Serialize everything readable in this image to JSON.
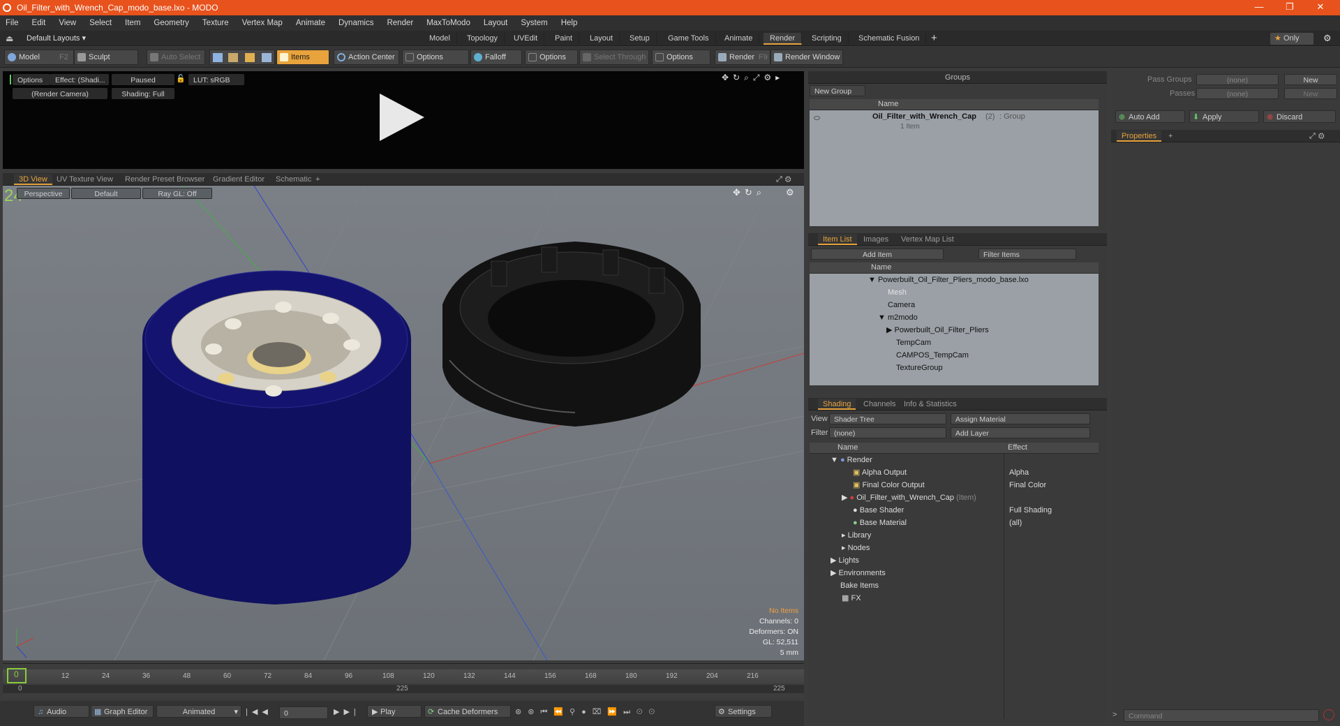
{
  "window": {
    "title": "Oil_Filter_with_Wrench_Cap_modo_base.lxo - MODO",
    "controls": [
      "—",
      "❐",
      "✕"
    ]
  },
  "menu": [
    "File",
    "Edit",
    "View",
    "Select",
    "Item",
    "Geometry",
    "Texture",
    "Vertex Map",
    "Animate",
    "Dynamics",
    "Render",
    "MaxToModo",
    "Layout",
    "System",
    "Help"
  ],
  "layout": {
    "dropdown": "Default Layouts ▾",
    "tabs": [
      "Model",
      "Topology",
      "UVEdit",
      "Paint",
      "Layout",
      "Setup",
      "Game Tools",
      "Animate",
      "Render",
      "Scripting",
      "Schematic Fusion"
    ],
    "active_tab": "Render",
    "plus": "+",
    "only": "Only"
  },
  "toolbar": {
    "model": "Model",
    "model_key": "F2",
    "sculpt": "Sculpt",
    "auto_select": "Auto Select",
    "items": "Items",
    "action_center": "Action Center",
    "options1": "Options",
    "falloff": "Falloff",
    "options2": "Options",
    "select_through": "Select Through",
    "options3": "Options",
    "render": "Render",
    "render_key": "F9",
    "render_window": "Render Window"
  },
  "preview": {
    "options": "Options",
    "effect": "Effect: (Shadi...",
    "paused": "Paused",
    "lut": "LUT: sRGB",
    "camera": "(Render Camera)",
    "shading": "Shading: Full"
  },
  "viewport_tabs": [
    "3D View",
    "UV Texture View",
    "Render Preset Browser",
    "Gradient Editor",
    "Schematic"
  ],
  "viewport": {
    "perspective": "Perspective",
    "default": "Default",
    "raygl": "Ray GL: Off",
    "stats": [
      "No Items",
      "Channels: 0",
      "Deformers: ON",
      "GL: 52,511",
      "5 mm"
    ]
  },
  "timeline": {
    "ticks": [
      "0",
      "12",
      "24",
      "36",
      "48",
      "60",
      "72",
      "84",
      "96",
      "108",
      "120",
      "132",
      "144",
      "156",
      "168",
      "180",
      "192",
      "204",
      "216"
    ],
    "start": "0",
    "mid": "225",
    "end": "225"
  },
  "bottom": {
    "audio": "Audio",
    "graph_editor": "Graph Editor",
    "animated": "Animated",
    "frame": "0",
    "play": "Play",
    "cache": "Cache Deformers",
    "settings": "Settings"
  },
  "groups": {
    "title": "Groups",
    "new_group": "New Group",
    "col_name": "Name",
    "item_name": "Oil_Filter_with_Wrench_Cap",
    "item_count": "(2)",
    "item_type": ": Group",
    "item_sub": "1 Item"
  },
  "itemlist": {
    "tabs": [
      "Item List",
      "Images",
      "Vertex Map List"
    ],
    "add_item": "Add Item",
    "filter": "Filter Items",
    "col_name": "Name",
    "rows": [
      {
        "label": "Powerbuilt_Oil_Filter_Pliers_modo_base.lxo",
        "indent": 0,
        "arrow": "▼",
        "dim": false
      },
      {
        "label": "Mesh",
        "indent": 1,
        "arrow": "",
        "dim": true
      },
      {
        "label": "Camera",
        "indent": 1,
        "arrow": "",
        "dim": false
      },
      {
        "label": "m2modo",
        "indent": 1,
        "arrow": "▼",
        "dim": false
      },
      {
        "label": "Powerbuilt_Oil_Filter_Pliers",
        "indent": 2,
        "arrow": "▶",
        "dim": false
      },
      {
        "label": "TempCam",
        "indent": 2,
        "arrow": "",
        "dim": false
      },
      {
        "label": "CAMPOS_TempCam",
        "indent": 2,
        "arrow": "",
        "dim": false
      },
      {
        "label": "TextureGroup",
        "indent": 2,
        "arrow": "",
        "dim": false
      }
    ]
  },
  "shading": {
    "tabs": [
      "Shading",
      "Channels",
      "Info & Statistics"
    ],
    "view_label": "View",
    "view_value": "Shader Tree",
    "assign": "Assign Material",
    "filter_label": "Filter",
    "filter_value": "(none)",
    "add_layer": "Add Layer",
    "col_name": "Name",
    "col_effect": "Effect",
    "rows": [
      {
        "label": "Render",
        "effect": "",
        "indent": 0,
        "extra": ""
      },
      {
        "label": "Alpha Output",
        "effect": "Alpha",
        "indent": 1,
        "extra": ""
      },
      {
        "label": "Final Color Output",
        "effect": "Final Color",
        "indent": 1,
        "extra": ""
      },
      {
        "label": "Oil_Filter_with_Wrench_Cap",
        "effect": "",
        "indent": 1,
        "extra": "(Item)"
      },
      {
        "label": "Base Shader",
        "effect": "Full Shading",
        "indent": 1,
        "extra": ""
      },
      {
        "label": "Base Material",
        "effect": "(all)",
        "indent": 1,
        "extra": ""
      },
      {
        "label": "Library",
        "effect": "",
        "indent": 1,
        "extra": ""
      },
      {
        "label": "Nodes",
        "effect": "",
        "indent": 1,
        "extra": ""
      },
      {
        "label": "Lights",
        "effect": "",
        "indent": 0,
        "extra": ""
      },
      {
        "label": "Environments",
        "effect": "",
        "indent": 0,
        "extra": ""
      },
      {
        "label": "Bake Items",
        "effect": "",
        "indent": 0,
        "extra": ""
      },
      {
        "label": "FX",
        "effect": "",
        "indent": 0,
        "extra": ""
      }
    ]
  },
  "props": {
    "pass_groups": "Pass Groups",
    "passes": "Passes",
    "none": "(none)",
    "new": "New",
    "auto_add": "Auto Add",
    "apply": "Apply",
    "discard": "Discard",
    "properties": "Properties",
    "command": "Command"
  },
  "colors": {
    "accent": "#e8a33c",
    "titlebar": "#e8521c",
    "filter_blue": "#0a0a6a"
  }
}
